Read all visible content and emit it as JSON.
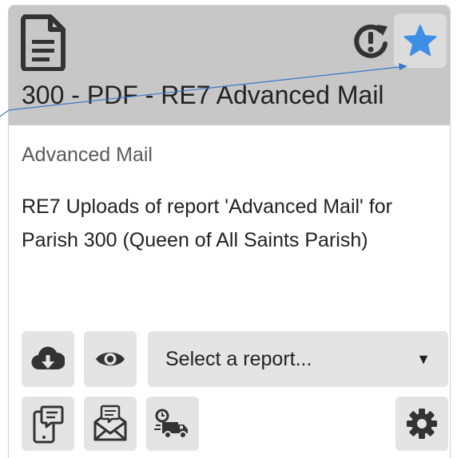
{
  "card": {
    "title": "300 - PDF - RE7 Advanced Mail",
    "subtitle": "Advanced Mail",
    "description": "RE7 Uploads of report 'Advanced Mail' for Parish 300 (Queen of All Saints Parish)"
  },
  "header_icons": {
    "document": "file-text-icon",
    "status": "alert-refresh-icon",
    "favorite": "star-icon"
  },
  "actions": {
    "row1": [
      "cloud-download-icon",
      "eye-icon"
    ],
    "row2": [
      "phone-message-icon",
      "envelope-message-icon",
      "scheduled-delivery-truck-icon",
      "gear-icon"
    ]
  },
  "report_select": {
    "value": "Select a report...",
    "caret": "▼"
  },
  "colors": {
    "header_bg": "#c7c7c7",
    "button_bg": "#e4e4e4",
    "star": "#3d8fe6",
    "icon": "#333333"
  }
}
